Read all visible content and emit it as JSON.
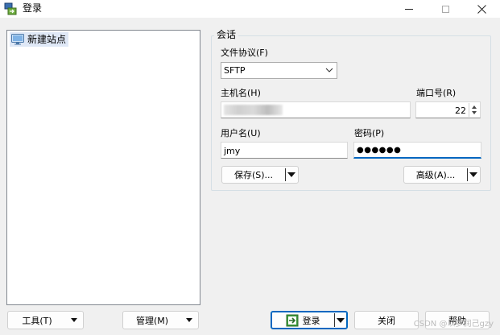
{
  "window": {
    "title": "登录",
    "icon": "winscp-login-icon"
  },
  "site_tree": {
    "items": [
      {
        "label": "新建站点",
        "icon": "monitor-site-icon",
        "selected": true
      }
    ]
  },
  "session": {
    "group_title": "会话",
    "protocol_label": "文件协议(F)",
    "protocol_value": "SFTP",
    "host_label": "主机名(H)",
    "host_value": "",
    "port_label": "端口号(R)",
    "port_value": "22",
    "user_label": "用户名(U)",
    "user_value": "jmy",
    "password_label": "密码(P)",
    "password_value": "●●●●●●",
    "save_label": "保存(S)...",
    "advanced_label": "高级(A)..."
  },
  "footer": {
    "tools_label": "工具(T)",
    "manage_label": "管理(M)",
    "login_label": "登录",
    "close_label": "关闭",
    "help_label": "帮助"
  },
  "watermark": "CSDN @以梦润己gzy",
  "colors": {
    "accent": "#0067c0",
    "selection": "#dfe8f6"
  }
}
